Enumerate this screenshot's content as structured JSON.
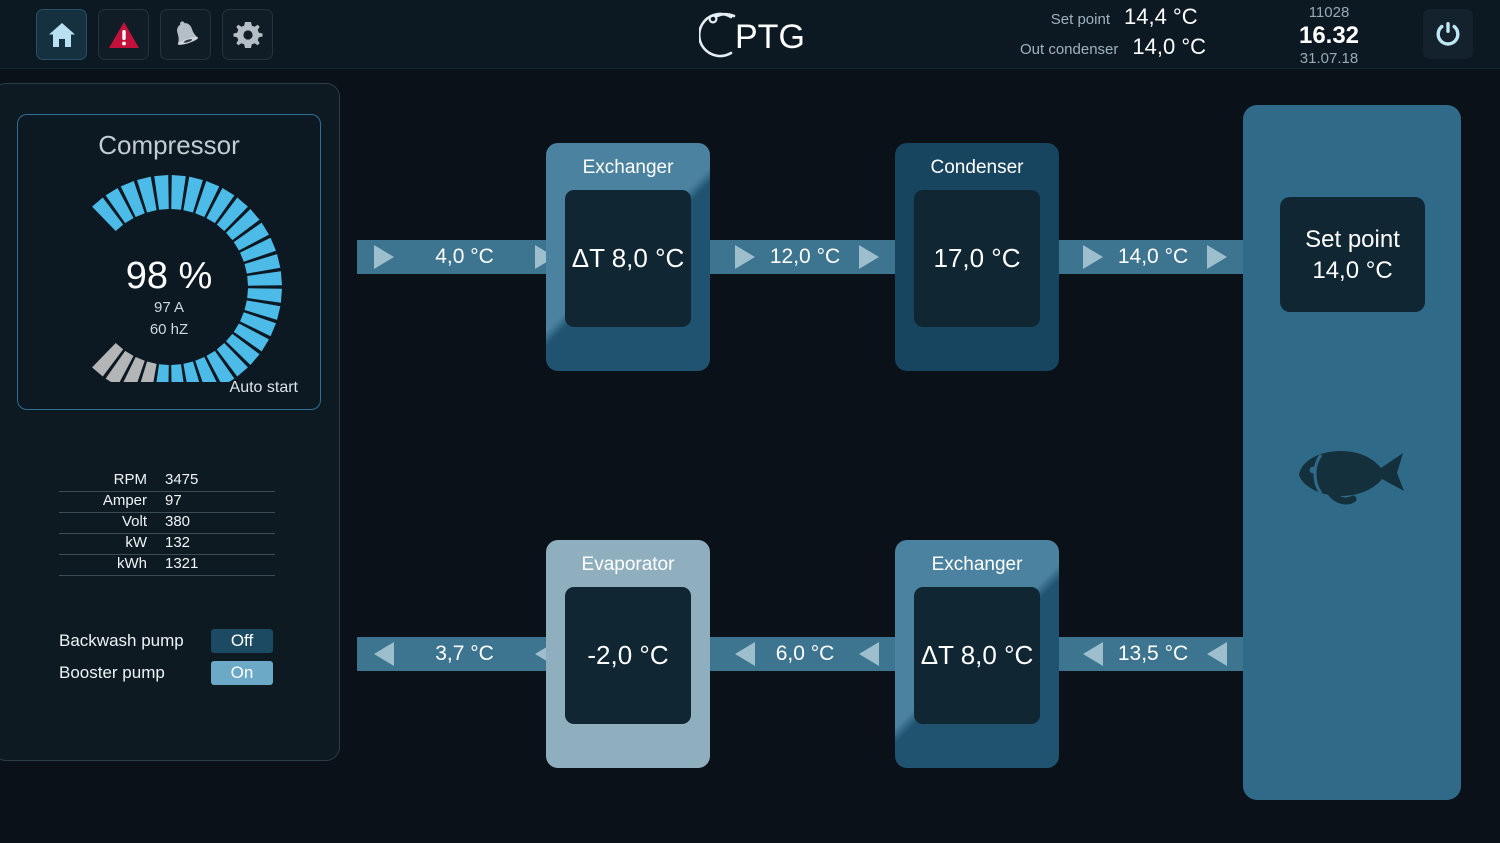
{
  "header": {
    "icons": [
      {
        "name": "home-icon",
        "label": "Home",
        "active": true
      },
      {
        "name": "alarm-warning-icon",
        "label": "Alarms",
        "active": false
      },
      {
        "name": "bell-icon",
        "label": "Notifications",
        "active": false
      },
      {
        "name": "gear-icon",
        "label": "Settings",
        "active": false
      }
    ],
    "logo_text": "PTG",
    "readings": [
      {
        "label": "Set point",
        "value": "14,4 °C"
      },
      {
        "label": "Out condenser",
        "value": "14,0 °C"
      }
    ],
    "clock": {
      "counter": "11028",
      "time": "16.32",
      "date": "31.07.18"
    },
    "power_button": "power-icon"
  },
  "sidebar": {
    "gauge": {
      "title": "Compressor",
      "percent_label": "98 %",
      "percent_value": 98,
      "amper_label": "97 A",
      "frequency_label": "60 hZ",
      "auto_start_label": "Auto start",
      "segments_total": 30,
      "segments_filled": 26,
      "fill_color": "#4cbbe8",
      "empty_color": "#b3b5b6"
    },
    "spec_table": {
      "rows": [
        {
          "key": "RPM",
          "value": "3475"
        },
        {
          "key": "Amper",
          "value": "97"
        },
        {
          "key": "Volt",
          "value": "380"
        },
        {
          "key": "kW",
          "value": "132"
        },
        {
          "key": "kWh",
          "value": "1321"
        }
      ]
    },
    "pumps": [
      {
        "label": "Backwash pump",
        "state": "Off",
        "on": false
      },
      {
        "label": "Booster pump",
        "state": "On",
        "on": true
      }
    ]
  },
  "diagram": {
    "top_pipes": [
      {
        "value": "4,0 °C",
        "direction": "right"
      },
      {
        "value": "12,0 °C",
        "direction": "right"
      },
      {
        "value": "14,0 °C",
        "direction": "right"
      }
    ],
    "bottom_pipes": [
      {
        "value": "3,7 °C",
        "direction": "left"
      },
      {
        "value": "6,0 °C",
        "direction": "left"
      },
      {
        "value": "13,5 °C",
        "direction": "left"
      }
    ],
    "blocks": [
      {
        "id": "exchanger-top",
        "title": "Exchanger",
        "value": "ΔT 8,0 °C",
        "style": "exchanger"
      },
      {
        "id": "condenser",
        "title": "Condenser",
        "value": "17,0 °C",
        "style": "condenser"
      },
      {
        "id": "evaporator",
        "title": "Evaporator",
        "value": "-2,0 °C",
        "style": "evaporator"
      },
      {
        "id": "exchanger-bottom",
        "title": "Exchanger",
        "value": "ΔT 8,0 °C",
        "style": "exchanger"
      }
    ],
    "tank": {
      "setpoint_title": "Set point",
      "setpoint_value": "14,0 °C",
      "icon": "fish-icon",
      "color": "#2f6a88"
    }
  },
  "colors": {
    "background": "#0b1118",
    "header_bg": "#0d1922",
    "pipe": "#3d748f",
    "arrow": "#9dbecd",
    "accent": "#4cbbe8",
    "alarm_red": "#c2123c"
  }
}
